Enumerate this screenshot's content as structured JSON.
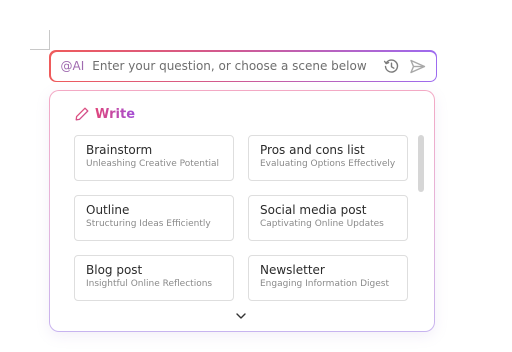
{
  "ai_bar": {
    "prefix": "@AI",
    "placeholder": "Enter your question, or choose a scene below",
    "value": "",
    "history_icon": "history-clock-icon",
    "send_icon": "send-arrow-icon"
  },
  "panel": {
    "section_title": "Write",
    "section_icon": "pen-icon",
    "scenes": [
      {
        "title": "Brainstorm",
        "subtitle": "Unleashing Creative Potential"
      },
      {
        "title": "Pros and cons list",
        "subtitle": "Evaluating Options Effectively"
      },
      {
        "title": "Outline",
        "subtitle": "Structuring Ideas Efficiently"
      },
      {
        "title": "Social media post",
        "subtitle": "Captivating Online Updates"
      },
      {
        "title": "Blog post",
        "subtitle": "Insightful Online Reflections"
      },
      {
        "title": "Newsletter",
        "subtitle": "Engaging Information Digest"
      }
    ],
    "expand_icon": "chevron-down-icon"
  },
  "colors": {
    "gradient_start": "#ef5b5b",
    "gradient_end": "#9d6bf0",
    "accent_pink": "#e0457b",
    "accent_purple": "#a44fd6"
  }
}
